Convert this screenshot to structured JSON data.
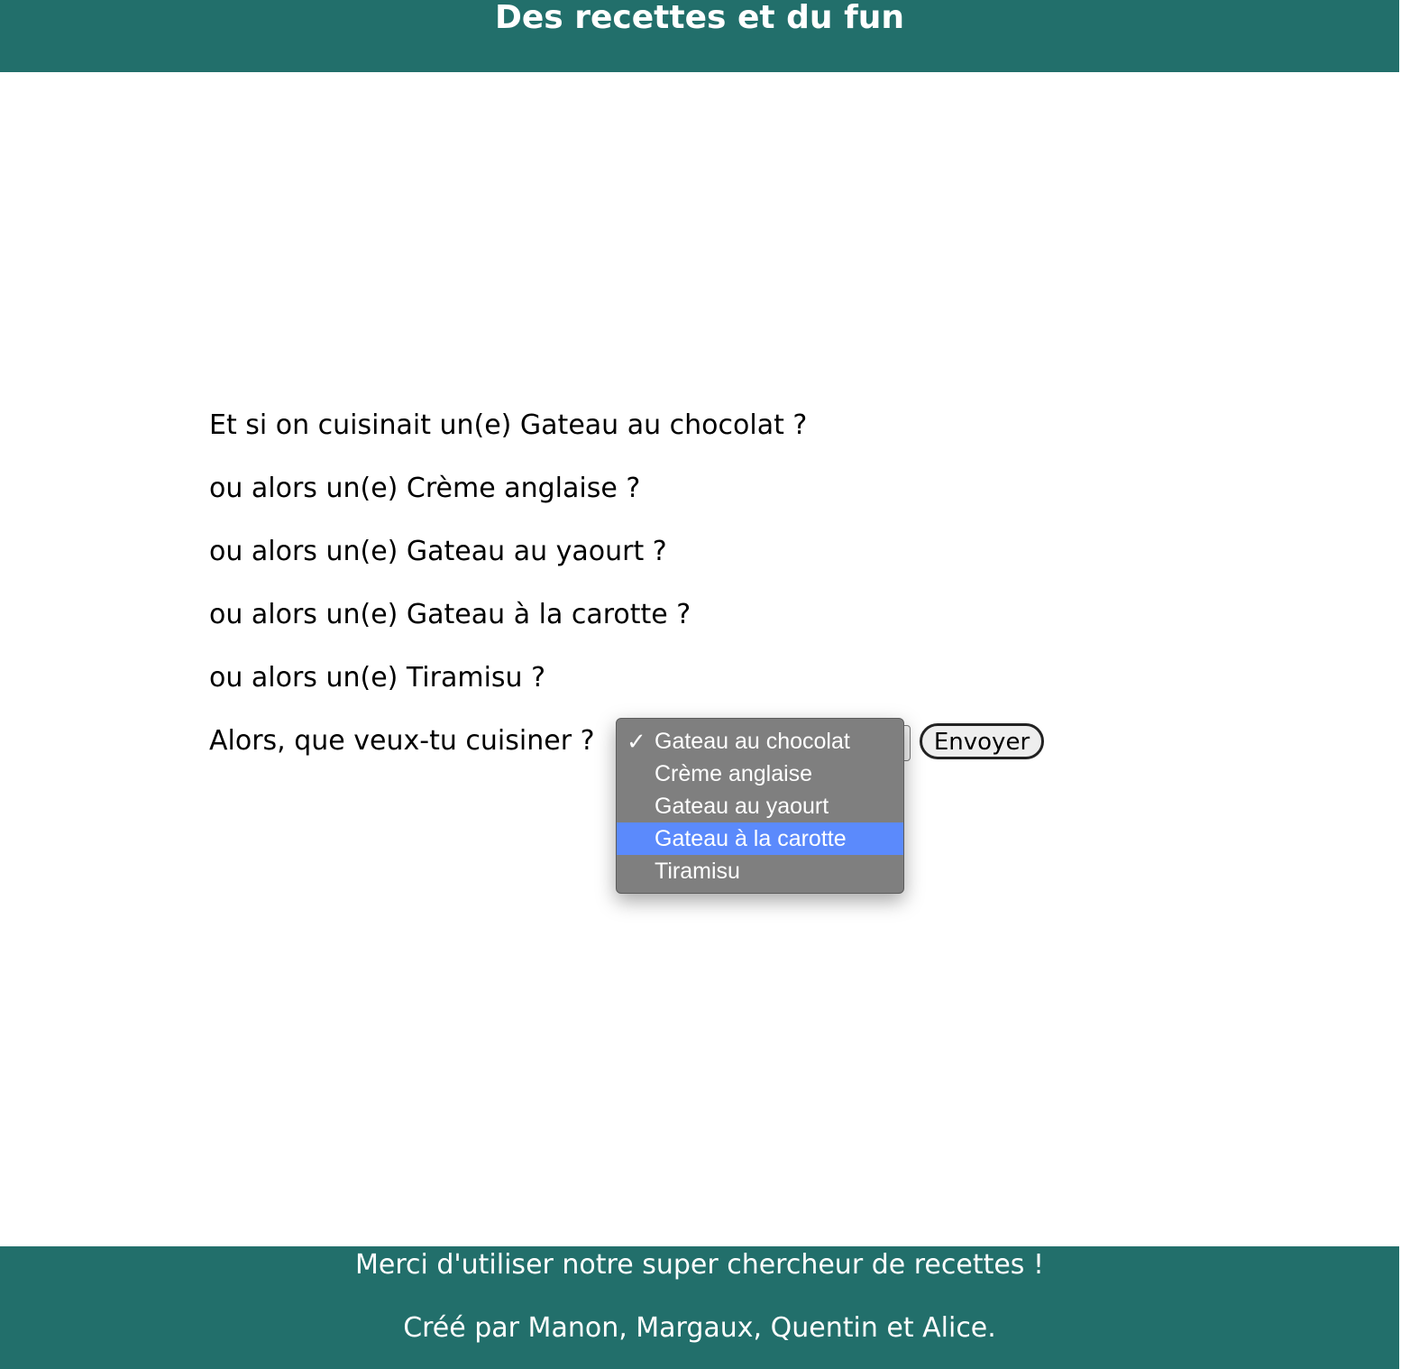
{
  "header": {
    "title": "Des recettes et du fun"
  },
  "suggestions": {
    "first": "Et si on cuisinait un(e) Gateau au chocolat ?",
    "others": [
      "ou alors un(e) Crème anglaise ?",
      "ou alors un(e) Gateau au yaourt ?",
      "ou alors un(e) Gateau à la carotte ?",
      "ou alors un(e) Tiramisu ?"
    ]
  },
  "form": {
    "question": "Alors, que veux-tu cuisiner ?",
    "submit_label": "Envoyer",
    "selected_value": "Gateau au chocolat",
    "highlighted_value": "Gateau à la carotte",
    "options": [
      "Gateau au chocolat",
      "Crème anglaise",
      "Gateau au yaourt",
      "Gateau à la carotte",
      "Tiramisu"
    ],
    "check_mark": "✓"
  },
  "footer": {
    "thanks": "Merci d'utiliser notre super chercheur de recettes !",
    "credits": "Créé par Manon, Margaux, Quentin et Alice."
  },
  "colors": {
    "header_bg": "#226f6b",
    "footer_bg": "#226f6b",
    "dropdown_bg": "#7f7f7f",
    "highlight": "#5b8afc"
  }
}
